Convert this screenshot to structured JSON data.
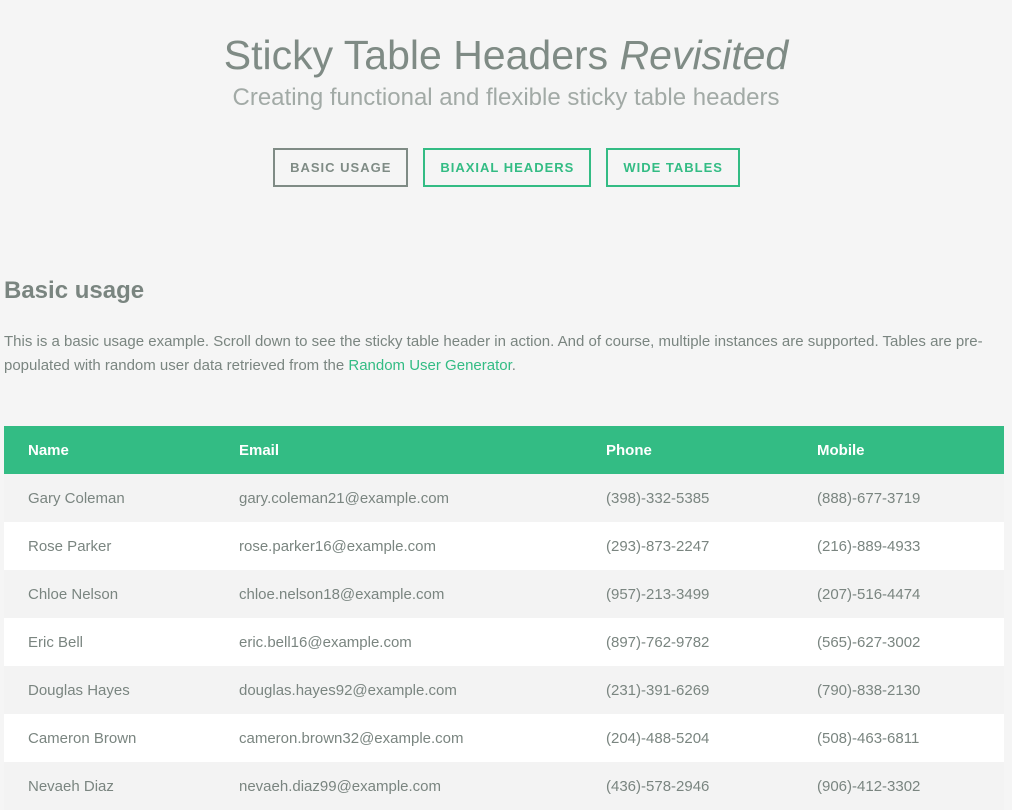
{
  "header": {
    "title_main": "Sticky Table Headers",
    "title_italic": "Revisited",
    "subtitle": "Creating functional and flexible sticky table headers"
  },
  "nav": [
    {
      "label": "BASIC USAGE",
      "active": true
    },
    {
      "label": "BIAXIAL HEADERS",
      "active": false
    },
    {
      "label": "WIDE TABLES",
      "active": false
    }
  ],
  "section": {
    "title": "Basic usage",
    "desc_before": "This is a basic usage example. Scroll down to see the sticky table header in action. And of course, multiple instances are supported. Tables are pre-populated with random user data retrieved from the ",
    "link_text": "Random User Generator",
    "desc_after": "."
  },
  "table": {
    "columns": [
      "Name",
      "Email",
      "Phone",
      "Mobile"
    ],
    "rows": [
      [
        "Gary Coleman",
        "gary.coleman21@example.com",
        "(398)-332-5385",
        "(888)-677-3719"
      ],
      [
        "Rose Parker",
        "rose.parker16@example.com",
        "(293)-873-2247",
        "(216)-889-4933"
      ],
      [
        "Chloe Nelson",
        "chloe.nelson18@example.com",
        "(957)-213-3499",
        "(207)-516-4474"
      ],
      [
        "Eric Bell",
        "eric.bell16@example.com",
        "(897)-762-9782",
        "(565)-627-3002"
      ],
      [
        "Douglas Hayes",
        "douglas.hayes92@example.com",
        "(231)-391-6269",
        "(790)-838-2130"
      ],
      [
        "Cameron Brown",
        "cameron.brown32@example.com",
        "(204)-488-5204",
        "(508)-463-6811"
      ],
      [
        "Nevaeh Diaz",
        "nevaeh.diaz99@example.com",
        "(436)-578-2946",
        "(906)-412-3302"
      ]
    ]
  },
  "colors": {
    "accent": "#33bc84",
    "text": "#7a8580",
    "background": "#f5f5f5"
  }
}
